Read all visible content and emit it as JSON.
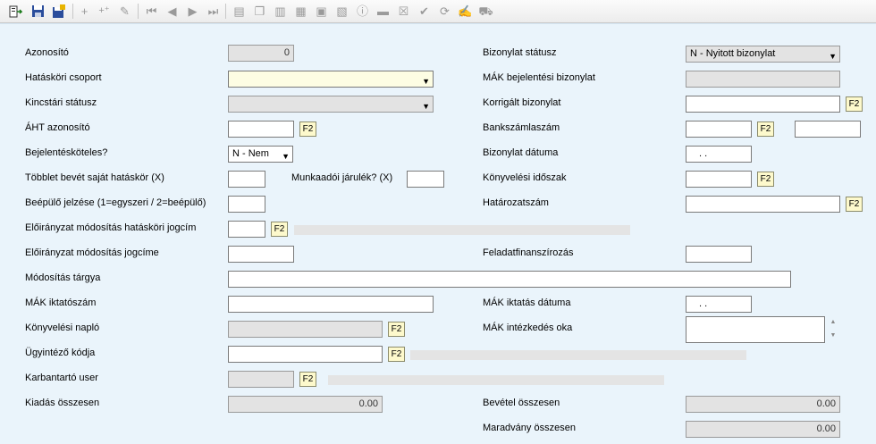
{
  "toolbar": {
    "icons": [
      "import-icon",
      "save-icon",
      "save-all-icon",
      "add-icon",
      "add-multiple-icon",
      "edit-icon",
      "first-record-icon",
      "previous-record-icon",
      "next-record-icon",
      "last-record-icon",
      "folder-icon",
      "copy-icon",
      "columns-icon",
      "paste-icon",
      "stamp-icon",
      "print-preview-icon",
      "preview-icon",
      "info-icon",
      "print-icon",
      "delete-icon",
      "approve-icon",
      "refresh-icon",
      "edit-doc-icon",
      "truck-icon"
    ]
  },
  "form": {
    "azonosito": {
      "label": "Azonosító",
      "value": "0"
    },
    "hataskori_csoport": {
      "label": "Hatásköri csoport",
      "value": ""
    },
    "kincstari_statusz": {
      "label": "Kincstári státusz",
      "value": ""
    },
    "aht_azonosito": {
      "label": "ÁHT azonosító",
      "value": ""
    },
    "bejelentokoteles": {
      "label": "Bejelentésköteles?",
      "value": "N - Nem"
    },
    "tobblet_bevet": {
      "label": "Többlet bevét saját hatáskör (X)",
      "value": ""
    },
    "munkaadoi_jarulek": {
      "label": "Munkaadói járulék? (X)",
      "value": ""
    },
    "beepulo_jelzese": {
      "label": "Beépülő jelzése (1=egyszeri / 2=beépülő)",
      "value": ""
    },
    "eloiranyzat_hataskori": {
      "label": "Előirányzat módosítás hatásköri jogcím",
      "value": ""
    },
    "eloiranyzat_jogcime": {
      "label": "Előirányzat módosítás jogcíme",
      "value": ""
    },
    "modositas_targya": {
      "label": "Módosítás tárgya",
      "value": ""
    },
    "mak_iktatoszam": {
      "label": "MÁK iktatószám",
      "value": ""
    },
    "konyvelesi_naplo": {
      "label": "Könyvelési napló",
      "value": ""
    },
    "ugyintezo_kodja": {
      "label": "Ügyintéző kódja",
      "value": ""
    },
    "karbantarto_user": {
      "label": "Karbantartó user",
      "value": ""
    },
    "kiadas_osszesen": {
      "label": "Kiadás összesen",
      "value": "0.00"
    },
    "bizonylat_statusz": {
      "label": "Bizonylat státusz",
      "value": "N - Nyitott bizonylat"
    },
    "mak_bejelentesi": {
      "label": "MÁK bejelentési bizonylat",
      "value": ""
    },
    "korrigalt_bizonylat": {
      "label": "Korrigált bizonylat",
      "value": ""
    },
    "bankszamlaszam": {
      "label": "Bankszámlaszám",
      "value": ""
    },
    "bizonylat_datuma": {
      "label": "Bizonylat dátuma",
      "value": ". ."
    },
    "konyvelesi_idoszak": {
      "label": "Könyvelési időszak",
      "value": ""
    },
    "hatarozatszam": {
      "label": "Határozatszám",
      "value": ""
    },
    "feladatfinanszirozas": {
      "label": "Feladatfinanszírozás",
      "value": ""
    },
    "mak_iktatas_datuma": {
      "label": "MÁK iktatás dátuma",
      "value": ". ."
    },
    "mak_intezkedes_oka": {
      "label": "MÁK intézkedés oka",
      "value": ""
    },
    "bevetel_osszesen": {
      "label": "Bevétel összesen",
      "value": "0.00"
    },
    "maradvany_osszesen": {
      "label": "Maradvány összesen",
      "value": "0.00"
    },
    "f2_label": "F2"
  }
}
